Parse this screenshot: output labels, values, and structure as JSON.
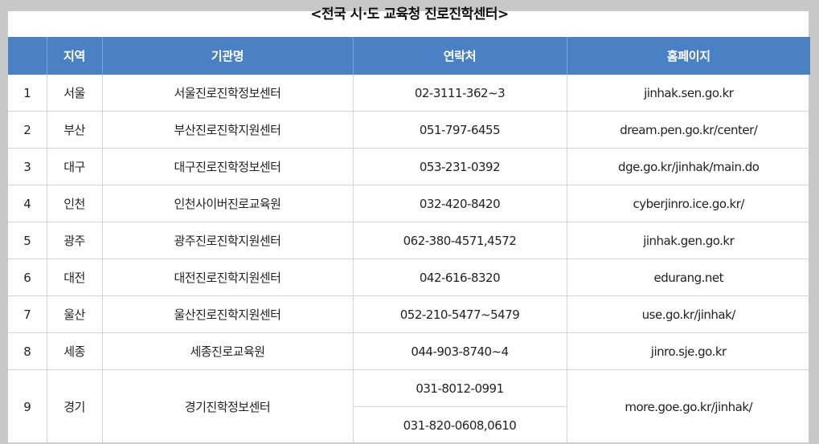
{
  "title": "<전국 시·도 교육청 진로진학센터>",
  "headers": [
    "",
    "지역",
    "기관명",
    "연락처",
    "홈페이지"
  ],
  "rows": [
    {
      "no": "1",
      "region": "서울",
      "org": "서울진로진학정보센터",
      "phone": "02-3111-362~3",
      "url": "jinhak.sen.go.kr"
    },
    {
      "no": "2",
      "region": "부산",
      "org": "부산진로진학지원센터",
      "phone": "051-797-6455",
      "url": "dream.pen.go.kr/center/"
    },
    {
      "no": "3",
      "region": "대구",
      "org": "대구진로진학정보센터",
      "phone": "053-231-0392",
      "url": "dge.go.kr/jinhak/main.do"
    },
    {
      "no": "4",
      "region": "인천",
      "org": "인천사이버진로교육원",
      "phone": "032-420-8420",
      "url": "cyberjinro.ice.go.kr/"
    },
    {
      "no": "5",
      "region": "광주",
      "org": "광주진로진학지원센터",
      "phone": "062-380-4571,4572",
      "url": "jinhak.gen.go.kr"
    },
    {
      "no": "6",
      "region": "대전",
      "org": "대전진로진학지원센터",
      "phone": "042-616-8320",
      "url": "edurang.net"
    },
    {
      "no": "7",
      "region": "울산",
      "org": "울산진로진학지원센터",
      "phone": "052-210-5477~5479",
      "url": "use.go.kr/jinhak/"
    },
    {
      "no": "8",
      "region": "세종",
      "org": "세종진로교육원",
      "phone": "044-903-8740~4",
      "url": "jinro.sje.go.kr"
    }
  ],
  "row9": {
    "no": "9",
    "region": "경기",
    "org": "경기진학정보센터",
    "phone1": "031-8012-0991",
    "phone2": "031-820-0608,0610",
    "url": "more.goe.go.kr/jinhak/"
  }
}
